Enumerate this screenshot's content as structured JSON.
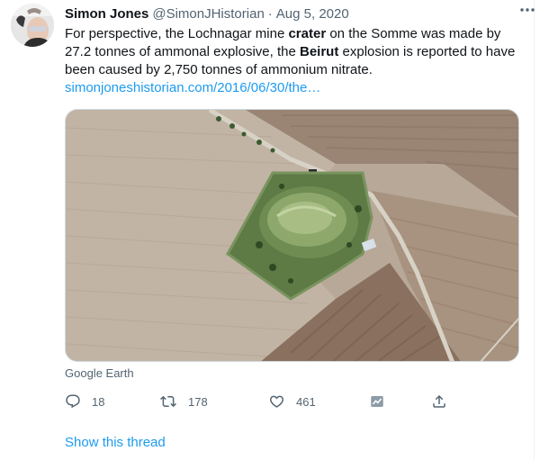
{
  "tweet": {
    "author": {
      "display_name": "Simon Jones",
      "handle": "@SimonJHistorian",
      "separator": "·",
      "date": "Aug 5, 2020",
      "avatar_icon": "avatar-photo"
    },
    "text": {
      "part1": "For perspective, the Lochnagar mine ",
      "bold1": "crater",
      "part2": " on the Somme was made by 27.2 tonnes of ammonal explosive, the ",
      "bold2": "Beirut",
      "part3": " explosion is reported to have been caused by 2,750 tonnes of ammonium nitrate."
    },
    "link": "simonjoneshistorian.com/2016/06/30/the…",
    "media_caption": "Google Earth",
    "more_icon": "more-horizontal-icon",
    "actions": {
      "reply": {
        "icon": "reply-icon",
        "count": "18"
      },
      "retweet": {
        "icon": "retweet-icon",
        "count": "178"
      },
      "like": {
        "icon": "heart-icon",
        "count": "461"
      },
      "analytics": {
        "icon": "analytics-icon"
      },
      "share": {
        "icon": "share-icon"
      }
    },
    "show_thread": "Show this thread"
  },
  "colors": {
    "text_primary": "#0f1419",
    "text_secondary": "#536471",
    "link": "#1d9bf0",
    "border": "#cfd9de"
  }
}
